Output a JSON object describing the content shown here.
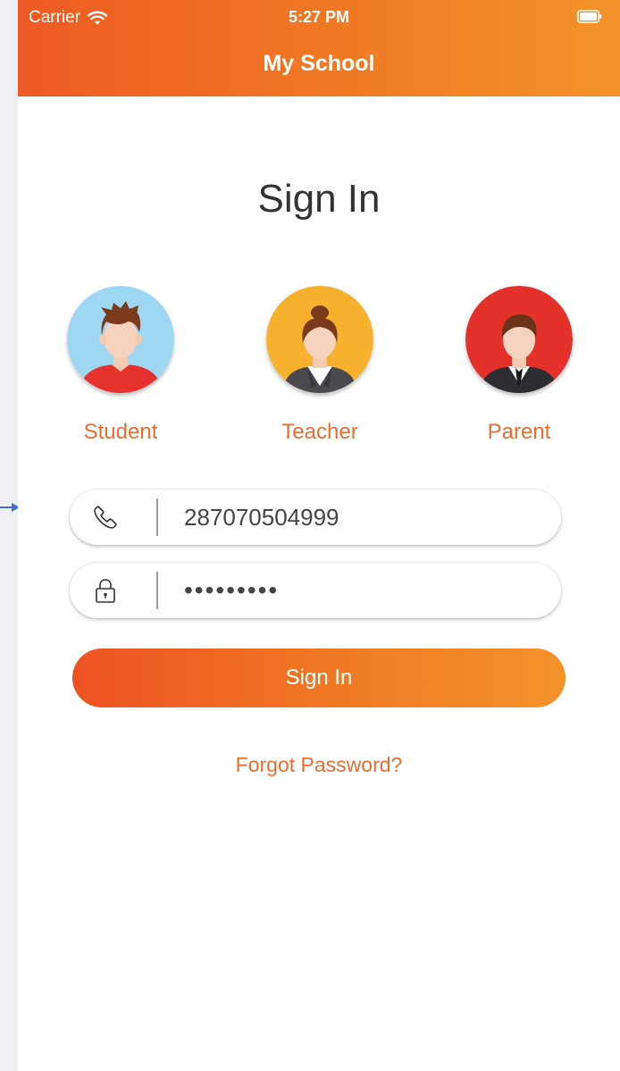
{
  "status_bar": {
    "carrier": "Carrier",
    "time": "5:27 PM"
  },
  "navbar": {
    "title": "My School"
  },
  "page": {
    "title": "Sign In"
  },
  "roles": [
    {
      "label": "Student",
      "avatar_color": "#9fd7f2",
      "icon": "student-avatar"
    },
    {
      "label": "Teacher",
      "avatar_color": "#f7b12e",
      "icon": "teacher-avatar"
    },
    {
      "label": "Parent",
      "avatar_color": "#e4312b",
      "icon": "parent-avatar"
    }
  ],
  "form": {
    "phone": {
      "value": "287070504999",
      "icon": "phone-icon"
    },
    "password": {
      "value": "•••••••••",
      "icon": "lock-icon"
    },
    "submit_label": "Sign In",
    "forgot_label": "Forgot Password?"
  },
  "colors": {
    "accent": "#ef6a2d",
    "gradient_start": "#ee5224",
    "gradient_end": "#f4922a"
  }
}
